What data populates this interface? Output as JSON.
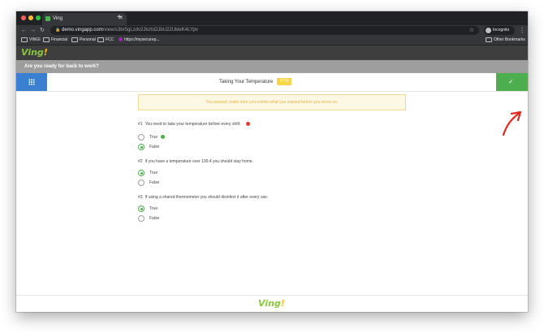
{
  "browser": {
    "tab_title": "Ving",
    "url_host": "demo.vingapp.com",
    "url_path": "/view/s3br5gLzdv2JkztsDJbU22UkleK4LYpv",
    "incognito_label": "Incognito",
    "bookmarks": [
      "VINGI",
      "Financial",
      "Personal",
      "FCC",
      "https://mysecurep...",
      "Other Bookmarks"
    ]
  },
  "app": {
    "logo_text": "Ving",
    "logo_bang": "!",
    "banner_title": "Are you ready for back to work?",
    "lesson_title": "Taking Your Temperature",
    "progress_label": "67%",
    "progress_value": 0.67,
    "alert": "You passed, make sure you review what you missed before you move on.",
    "questions": [
      {
        "num": "#1",
        "text": "You need to take your temperature before every shift.",
        "options": [
          "True",
          "False"
        ]
      },
      {
        "num": "#2",
        "text": "If you have a temperature over 100.4 you should stay home.",
        "options": [
          "True",
          "False"
        ]
      },
      {
        "num": "#3",
        "text": "If using a shared thermometer you should disinfect it after every use.",
        "options": [
          "True",
          "False"
        ]
      }
    ]
  },
  "colors": {
    "accent_green": "#4cae4f",
    "grid_blue": "#3b7fd1",
    "alert_text": "#e7b33e",
    "annotation_red": "#e0281c"
  }
}
